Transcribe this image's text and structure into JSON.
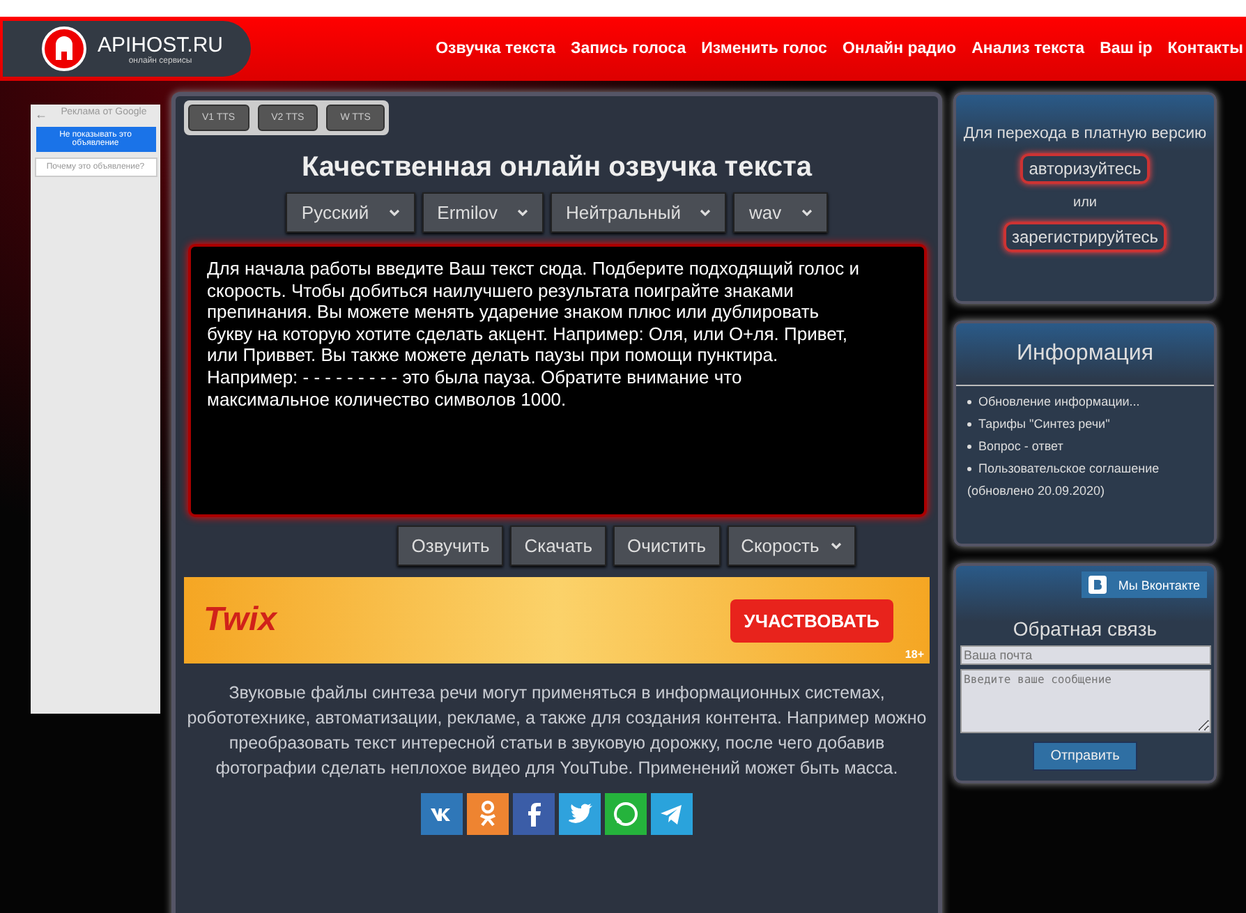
{
  "header": {
    "logo": "APIHOST.RU",
    "tagline": "онлайн сервисы",
    "nav": [
      "Озвучка текста",
      "Запись голоса",
      "Изменить голос",
      "Онлайн радио",
      "Анализ текста",
      "Ваш ip",
      "Контакты"
    ]
  },
  "ad_panel": {
    "back": "←",
    "title": "Реклама от Google",
    "hide_button": "Не показывать это объявление",
    "why_button": "Почему это объявление?"
  },
  "main": {
    "version_tabs": [
      "V1 TTS",
      "V2 TTS",
      "W TTS"
    ],
    "title": "Качественная онлайн озвучка текста",
    "selects": [
      "Русский",
      "Ermilov",
      "Нейтральный",
      "wav"
    ],
    "text": "Для начала работы введите Ваш текст сюда. Подберите подходящий голос и скорость. Чтобы добиться наилучшего результата поиграйте знаками препинания. Вы можете менять ударение знаком плюс или дублировать букву на которую хотите сделать акцент. Например: Оля, или О+ля. Привет, или Приввет. Вы также можете делать паузы при помощи пунктира. Например: - - - - - - - - - это была пауза. Обратите внимание что максимальное количество символов 1000.",
    "buttons": [
      "Озвучить",
      "Скачать",
      "Очистить"
    ],
    "speed_select": "Скорость",
    "banner": {
      "brand": "Twix",
      "cta": "УЧАСТВОВАТЬ",
      "age": "18+"
    },
    "description": "Звуковые файлы синтеза речи могут применяться в информационных системах, робототехнике, автоматизации, рекламе, а также для создания контента. Например можно преобразовать текст интересной статьи в звуковую дорожку, после чего добавив фотографии сделать неплохое видео для YouTube. Применений может быть масса."
  },
  "paid": {
    "text": "Для перехода в платную версию",
    "login": "авторизуйтесь",
    "or": "или",
    "register": "зарегистрируйтесь"
  },
  "info": {
    "title": "Информация",
    "links": [
      "Обновление информации...",
      "Тарифы \"Синтез речи\"",
      "Вопрос - ответ",
      "Пользовательское соглашение"
    ],
    "note": "(обновлено 20.09.2020)"
  },
  "feedback": {
    "vk_button": "Мы Вконтакте",
    "title": "Обратная связь",
    "email_placeholder": "Ваша почта",
    "message_placeholder": "Введите ваше сообщение",
    "submit": "Отправить"
  }
}
